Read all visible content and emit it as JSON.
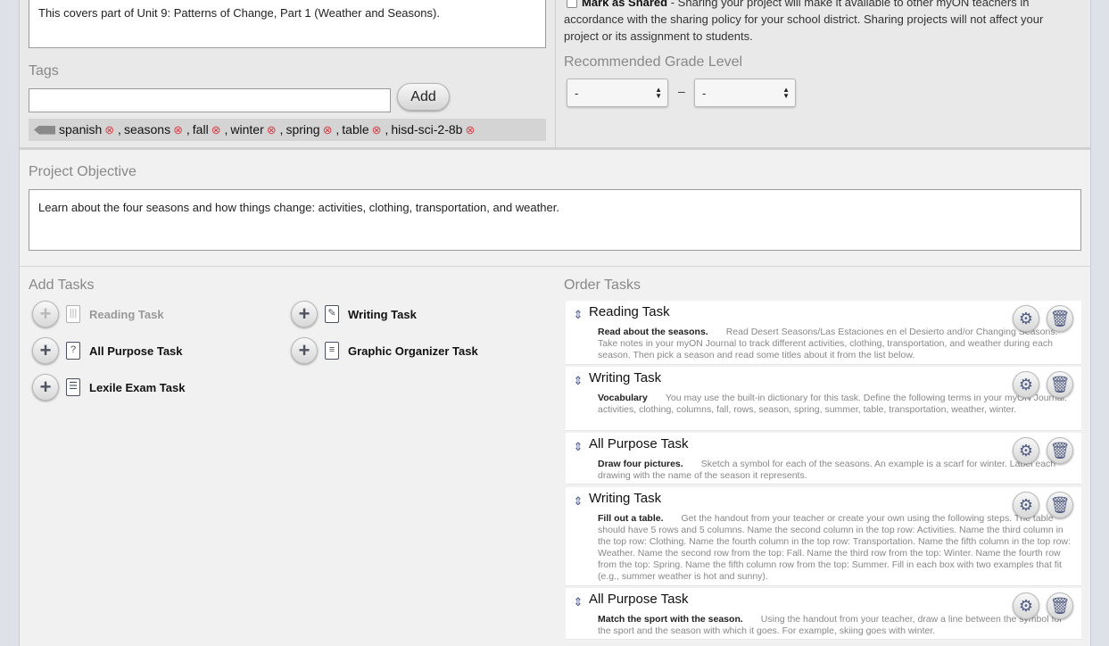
{
  "description": {
    "text": "This covers part of Unit 9: Patterns of Change, Part 1 (Weather and Seasons)."
  },
  "tags": {
    "label": "Tags",
    "input_value": "",
    "add_label": "Add",
    "remove_glyph": "⊗",
    "items": [
      "spanish",
      "seasons",
      "fall",
      "winter",
      "spring",
      "table",
      "hisd-sci-2-8b"
    ]
  },
  "sharing": {
    "checked": false,
    "bold": "Mark as Shared",
    "text": " - Sharing your project will make it available to other myON teachers in accordance with the sharing policy for your school district. Sharing projects will not affect your project or its assignment to students."
  },
  "grade": {
    "label": "Recommended Grade Level",
    "from": "-",
    "to": "-",
    "separator": "–"
  },
  "objective": {
    "label": "Project Objective",
    "text": "Learn about the four seasons and how things change: activities, clothing, transportation, and weather."
  },
  "add_tasks": {
    "label": "Add Tasks",
    "items": [
      {
        "label": "Reading Task",
        "icon": "books-icon",
        "disabled": true
      },
      {
        "label": "Writing Task",
        "icon": "pencil-paper-icon",
        "disabled": false
      },
      {
        "label": "All Purpose Task",
        "icon": "question-doc-icon",
        "disabled": false
      },
      {
        "label": "Graphic Organizer Task",
        "icon": "list-doc-icon",
        "disabled": false
      },
      {
        "label": "Lexile Exam Task",
        "icon": "exam-doc-icon",
        "disabled": false
      }
    ]
  },
  "order_tasks": {
    "label": "Order Tasks",
    "items": [
      {
        "title": "Reading Task",
        "heading": "Read about the seasons.",
        "text": "Read Desert Seasons/Las Estaciones en el Desierto and/or Changing Seasons. Take notes in your myON Journal to track different activities, clothing, transportation, and weather during each season. Then pick a season and read some titles about it from the list below."
      },
      {
        "title": "Writing Task",
        "heading": "Vocabulary",
        "text": "You may use the built-in dictionary for this task. Define the following terms in your myON Journal: activities, clothing, columns, fall, rows, season, spring, summer, table, transportation, weather, winter."
      },
      {
        "title": "All Purpose Task",
        "heading": "Draw four pictures.",
        "text": "Sketch a symbol for each of the seasons. An example is a scarf for winter. Label each drawing with the name of the season it represents."
      },
      {
        "title": "Writing Task",
        "heading": "Fill out a table.",
        "text": "Get the handout from your teacher or create your own using the following steps. The table should have 5 rows and 5 columns. Name the second column in the top row: Activities. Name the third column in the top row: Clothing. Name the fourth column in the top row: Transportation. Name the fifth column in the top row: Weather. Name the second row from the top: Fall. Name the third row from the top: Winter. Name the fourth row from the top: Spring. Name the fifth column row from the top: Summer. Fill in each box with two examples that fit (e.g., summer weather is hot and sunny)."
      },
      {
        "title": "All Purpose Task",
        "heading": "Match the sport with the season.",
        "text": "Using the handout from your teacher, draw a line between the symbol for the sport and the season with which it goes. For example, skiing goes with winter."
      }
    ]
  }
}
